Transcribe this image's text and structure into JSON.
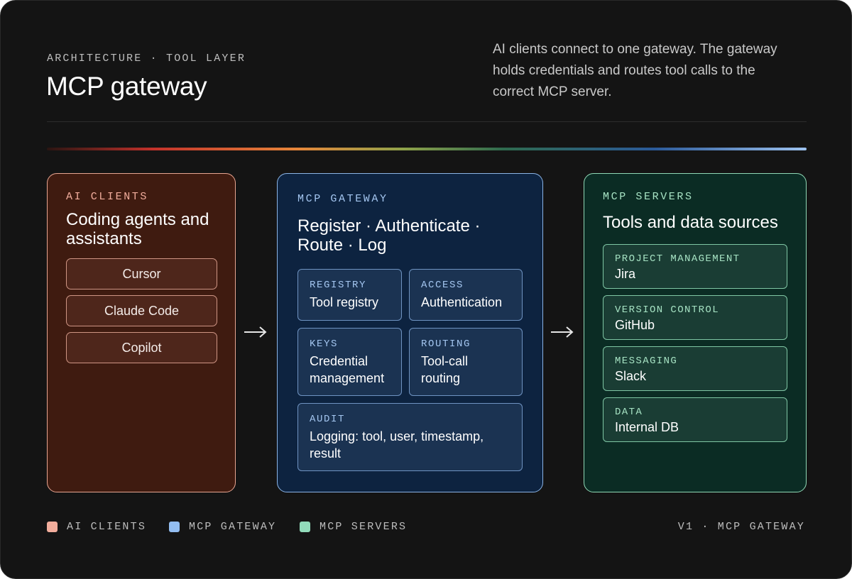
{
  "header": {
    "eyebrow": "ARCHITECTURE · TOOL LAYER",
    "title": "MCP gateway",
    "description": "AI clients connect to one gateway. The gateway holds credentials and routes tool calls to the correct MCP server."
  },
  "clients": {
    "tag": "AI CLIENTS",
    "heading": "Coding agents and assistants",
    "items": [
      {
        "label": "Cursor"
      },
      {
        "label": "Claude Code"
      },
      {
        "label": "Copilot"
      }
    ]
  },
  "gateway": {
    "tag": "MCP GATEWAY",
    "heading": "Register · Authenticate · Route · Log",
    "modules": [
      {
        "tag": "REGISTRY",
        "label": "Tool registry"
      },
      {
        "tag": "ACCESS",
        "label": "Authentication"
      },
      {
        "tag": "KEYS",
        "label": "Credential management"
      },
      {
        "tag": "ROUTING",
        "label": "Tool-call routing"
      },
      {
        "tag": "AUDIT",
        "label": "Logging: tool, user, timestamp, result"
      }
    ]
  },
  "servers": {
    "tag": "MCP SERVERS",
    "heading": "Tools and data sources",
    "items": [
      {
        "tag": "PROJECT MANAGEMENT",
        "label": "Jira"
      },
      {
        "tag": "VERSION CONTROL",
        "label": "GitHub"
      },
      {
        "tag": "MESSAGING",
        "label": "Slack"
      },
      {
        "tag": "DATA",
        "label": "Internal DB"
      }
    ]
  },
  "legend": {
    "items": [
      {
        "label": "AI CLIENTS",
        "color": "#f2ad9c"
      },
      {
        "label": "MCP GATEWAY",
        "color": "#93bdf0"
      },
      {
        "label": "MCP SERVERS",
        "color": "#92dcbb"
      }
    ]
  },
  "footer": {
    "version": "V1 · MCP GATEWAY"
  },
  "colors": {
    "background": "#141414",
    "clients_accent": "#f2ad9c",
    "gateway_accent": "#a4c6f0",
    "servers_accent": "#a6e2c3"
  }
}
